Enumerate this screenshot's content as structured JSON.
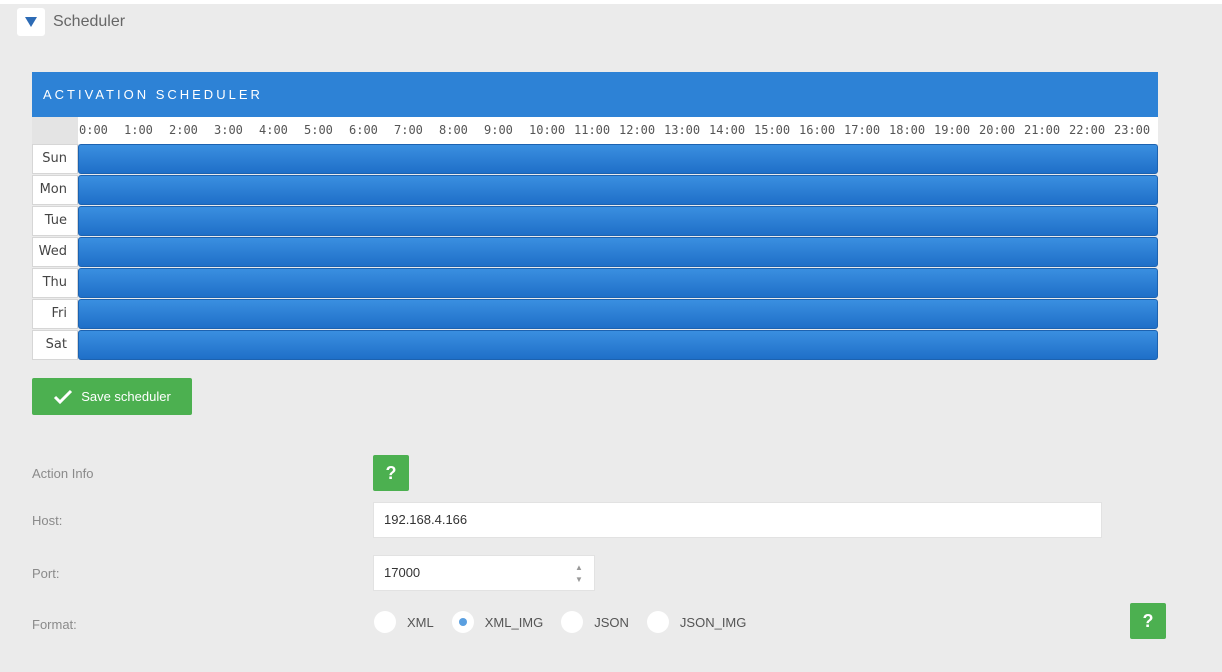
{
  "panel": {
    "title": "Scheduler"
  },
  "scheduler": {
    "title": "ACTIVATION SCHEDULER",
    "hours": [
      "0:00",
      "1:00",
      "2:00",
      "3:00",
      "4:00",
      "5:00",
      "6:00",
      "7:00",
      "8:00",
      "9:00",
      "10:00",
      "11:00",
      "12:00",
      "13:00",
      "14:00",
      "15:00",
      "16:00",
      "17:00",
      "18:00",
      "19:00",
      "20:00",
      "21:00",
      "22:00",
      "23:00"
    ],
    "days": [
      "Sun",
      "Mon",
      "Tue",
      "Wed",
      "Thu",
      "Fri",
      "Sat"
    ],
    "accent_color": "#2d82d6"
  },
  "save_button": {
    "label": "Save scheduler",
    "color": "#4cb050"
  },
  "form": {
    "action_info_label": "Action Info",
    "help_label": "?",
    "host_label": "Host:",
    "host_value": "192.168.4.166",
    "port_label": "Port:",
    "port_value": "17000",
    "format_label": "Format:",
    "format_options": [
      "XML",
      "XML_IMG",
      "JSON",
      "JSON_IMG"
    ],
    "format_selected": "XML_IMG"
  }
}
